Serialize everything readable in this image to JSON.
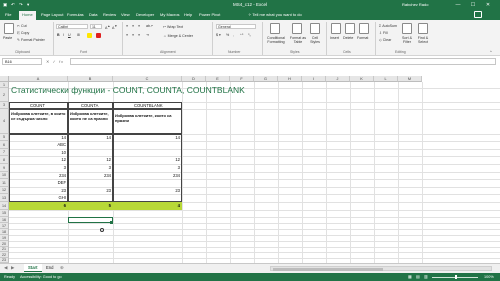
{
  "window": {
    "title": "MS4_c12 - Excel",
    "user": "Rabchev Rado",
    "controls": [
      "—",
      "☐",
      "✕"
    ]
  },
  "tabs": [
    "File",
    "Home",
    "Page Layout",
    "Formulas",
    "Data",
    "Review",
    "View",
    "Developer",
    "My Macros",
    "Help",
    "Power Pivot"
  ],
  "active_tab": "Home",
  "tell_me": "Tell me what you want to do",
  "ribbon": {
    "clipboard": {
      "cut": "Cut",
      "copy": "Copy",
      "format_painter": "Format Painter",
      "paste": "Paste",
      "label": "Clipboard"
    },
    "font": {
      "name": "Calibri",
      "size": "11",
      "label": "Font"
    },
    "alignment": {
      "wrap": "Wrap Text",
      "merge": "Merge & Center",
      "label": "Alignment"
    },
    "number": {
      "format": "General",
      "label": "Number"
    },
    "styles": {
      "conditional": "Conditional Formatting",
      "format_table": "Format as Table",
      "cell_styles": "Cell Styles",
      "label": "Styles"
    },
    "cells": {
      "insert": "Insert",
      "delete": "Delete",
      "format": "Format",
      "label": "Cells"
    },
    "editing": {
      "autosum": "AutoSum",
      "fill": "Fill",
      "clear": "Clear",
      "sort": "Sort & Filter",
      "find": "Find & Select",
      "label": "Editing"
    }
  },
  "formula_bar": {
    "name_box": "B16",
    "fx": "fx",
    "value": ""
  },
  "columns": [
    "A",
    "B",
    "C",
    "D",
    "E",
    "F",
    "G",
    "H",
    "I",
    "J",
    "K",
    "L",
    "M"
  ],
  "rows": [
    "1",
    "2",
    "3",
    "4",
    "5",
    "6",
    "7",
    "8",
    "9",
    "10",
    "11",
    "12",
    "13",
    "14",
    "15",
    "16",
    "17",
    "18",
    "19",
    "20",
    "21",
    "22",
    "23",
    "24",
    "25",
    "26",
    "27",
    "28",
    "29"
  ],
  "sheet": {
    "title": "Статистически функции - COUNT, COUNTA, COUNTBLANK",
    "headers": [
      "COUNT",
      "COUNTA",
      "COUNTBLANK"
    ],
    "descriptions": [
      "Изброява клетките, в които се съдържа число",
      "Изброява клетките, които не са празни",
      "Изброява клетките, които са празни"
    ],
    "colA": [
      "14",
      "ABC",
      "10",
      "12",
      "3",
      "234",
      "DEF",
      "23",
      "GHI"
    ],
    "colB": [
      "14",
      "",
      "",
      "12",
      "3",
      "234",
      "",
      "23",
      ""
    ],
    "colC": [
      "14",
      "",
      "",
      "12",
      "3",
      "234",
      "",
      "23",
      ""
    ],
    "results": [
      "6",
      "5",
      "4"
    ]
  },
  "sheet_tabs": [
    "Start",
    "End"
  ],
  "active_sheet": "Start",
  "status": {
    "ready": "Ready",
    "accessibility": "Accessibility: Good to go",
    "zoom": "100%"
  },
  "colors": {
    "accent": "#217346",
    "highlight": "#b8d837",
    "text_green": "#217346"
  }
}
